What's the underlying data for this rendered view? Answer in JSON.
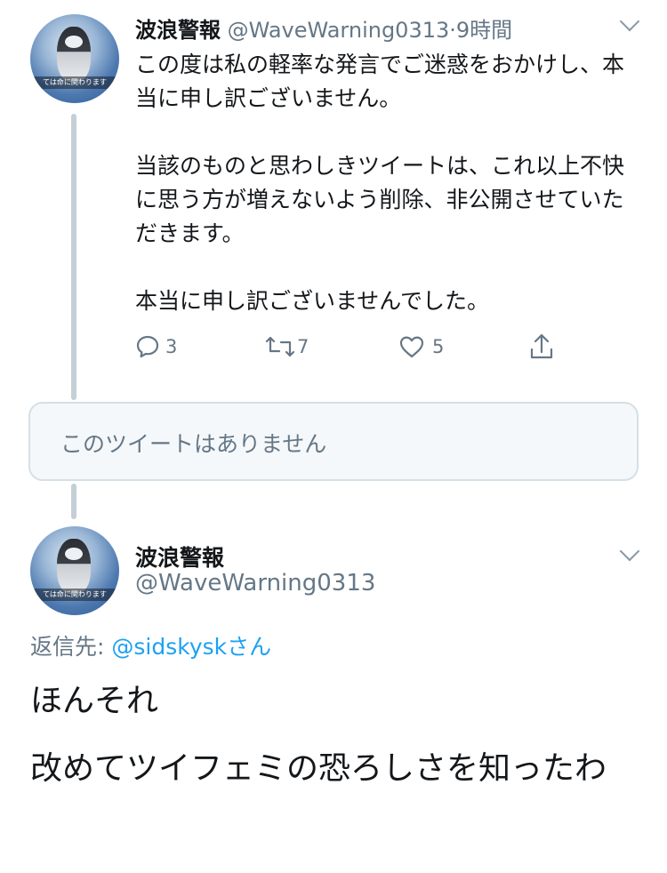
{
  "tweet1": {
    "avatar_caption": "ては命に関わります",
    "display_name": "波浪警報",
    "handle": "@WaveWarning0313",
    "separator": "·",
    "time": "9時間",
    "body_lines": [
      "この度は私の軽率な発言でご迷惑をおかけし、本当に申し訳ございません。",
      "当該のものと思わしきツイートは、これ以上不快に思う方が増えないよう削除、非公開させていただきます。",
      "本当に申し訳ございませんでした。"
    ],
    "reply_count": "3",
    "retweet_count": "7",
    "like_count": "5"
  },
  "unavailable": {
    "text": "このツイートはありません"
  },
  "tweet2": {
    "avatar_caption": "ては命に関わります",
    "display_name": "波浪警報",
    "handle": "@WaveWarning0313",
    "reply_prefix": "返信先: ",
    "reply_target": "@sidskysk",
    "reply_suffix": "さん",
    "body_lines": [
      "ほんそれ",
      "改めてツイフェミの恐ろしさを知ったわ"
    ]
  },
  "colors": {
    "link": "#1da1f2",
    "secondary": "#657786",
    "thread_line": "#c4cfd6"
  }
}
